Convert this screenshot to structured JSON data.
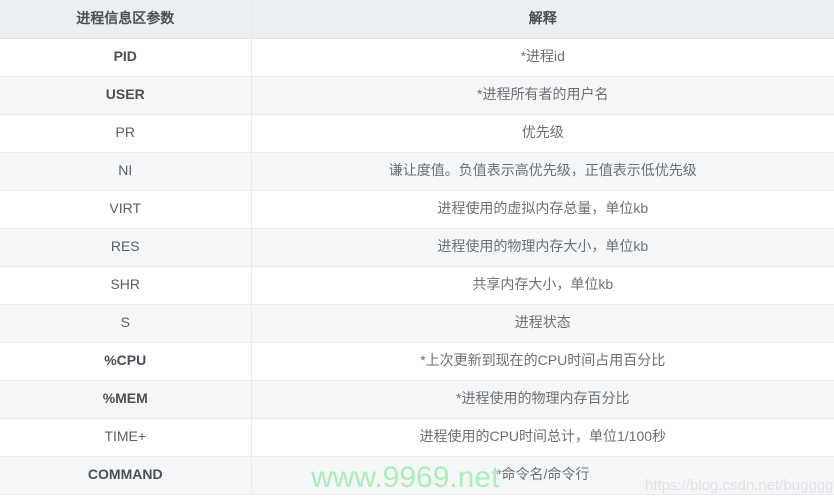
{
  "table": {
    "columns": [
      {
        "key": "param",
        "header": "进程信息区参数"
      },
      {
        "key": "desc",
        "header": "解释"
      }
    ],
    "rows": [
      {
        "param": "PID",
        "desc": "*进程id",
        "param_bold": true
      },
      {
        "param": "USER",
        "desc": "*进程所有者的用户名",
        "param_bold": true
      },
      {
        "param": "PR",
        "desc": "优先级",
        "param_bold": false
      },
      {
        "param": "NI",
        "desc": "谦让度值。负值表示高优先级，正值表示低优先级",
        "param_bold": false
      },
      {
        "param": "VIRT",
        "desc": "进程使用的虚拟内存总量，单位kb",
        "param_bold": false
      },
      {
        "param": "RES",
        "desc": "进程使用的物理内存大小，单位kb",
        "param_bold": false
      },
      {
        "param": "SHR",
        "desc": "共享内存大小，单位kb",
        "param_bold": false
      },
      {
        "param": "S",
        "desc": "进程状态",
        "param_bold": false
      },
      {
        "param": "%CPU",
        "desc": "*上次更新到现在的CPU时间占用百分比",
        "param_bold": true
      },
      {
        "param": "%MEM",
        "desc": "*进程使用的物理内存百分比",
        "param_bold": true
      },
      {
        "param": "TIME+",
        "desc": "进程使用的CPU时间总计，单位1/100秒",
        "param_bold": false
      },
      {
        "param": "COMMAND",
        "desc": "*命令名/命令行",
        "param_bold": true
      }
    ]
  },
  "watermarks": {
    "site": "www.9969.net",
    "blog": "https://blog.csdn.net/buggggggggg"
  },
  "colors": {
    "header_bg": "#eceff1",
    "row_odd_bg": "#ffffff",
    "row_even_bg": "#f5f6f7",
    "border": "#e8eaec",
    "text": "#5a5e66",
    "watermark_green": "#a9efb7",
    "watermark_gray": "#dfe1e6"
  }
}
